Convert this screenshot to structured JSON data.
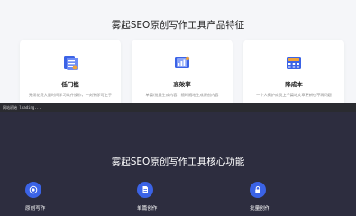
{
  "features_section": {
    "title": "雾起SEO原创写作工具产品特征",
    "cards": [
      {
        "title": "低门槛",
        "desc": "无须花费大量时间学习软件操作，一刻钟即可上手",
        "icon": "document-icon"
      },
      {
        "title": "高效率",
        "desc": "单篇/批量生成内容，随时随地生成原创内容",
        "icon": "analytics-icon"
      },
      {
        "title": "降成本",
        "desc": "一个人搞护成员上千篇站文章更新也不再问题",
        "icon": "calculator-icon"
      }
    ]
  },
  "toast": {
    "text": "网站初始 loading..."
  },
  "core_section": {
    "title": "雾起SEO原创写作工具核心功能",
    "features": [
      {
        "label": "原创写作",
        "icon": "target-icon"
      },
      {
        "label": "单篇创作",
        "icon": "document-icon"
      },
      {
        "label": "批量创作",
        "icon": "lock-icon"
      }
    ]
  },
  "colors": {
    "accent": "#3b63e6",
    "dark_bg": "#2d2d3f"
  }
}
